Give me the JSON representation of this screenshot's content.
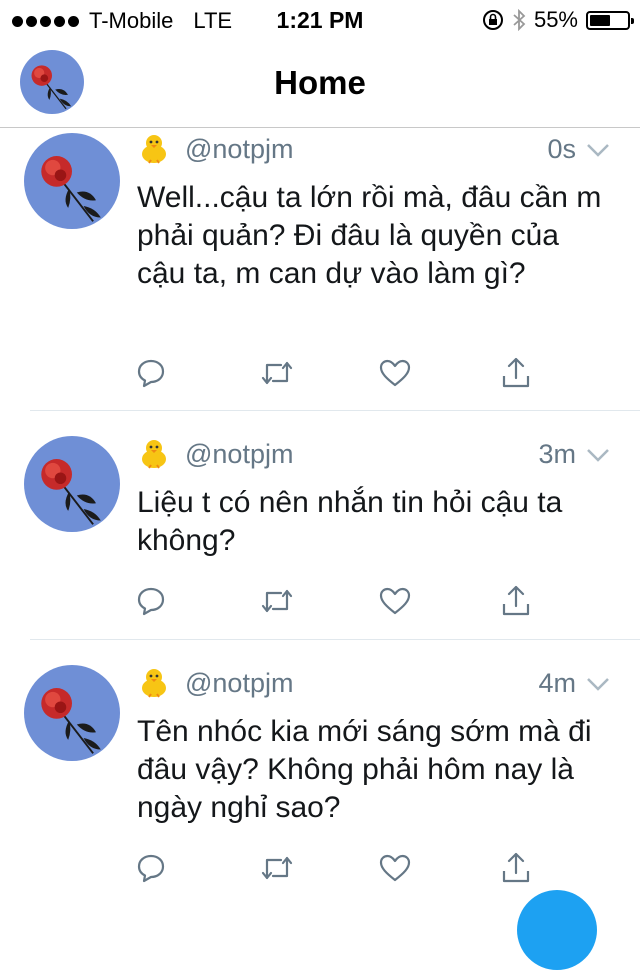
{
  "status_bar": {
    "carrier": "T-Mobile",
    "network": "LTE",
    "time": "1:21 PM",
    "battery_text": "55%",
    "battery_level": 0.55,
    "icons": [
      "signal-dots-icon",
      "rotation-lock-icon",
      "bluetooth-icon",
      "battery-icon"
    ]
  },
  "nav": {
    "title": "Home",
    "avatar_icon": "rose-avatar"
  },
  "colors": {
    "secondary_text": "#657786",
    "body_text": "#14171a",
    "avatar_bg": "#6f8fd6",
    "accent": "#1da1f2",
    "divider": "#e1e8ed"
  },
  "tweets": [
    {
      "handle": "@notpjm",
      "time": "0s",
      "text": "Well...cậu ta lớn rồi mà, đâu cần m phải quản? Đi đâu là quyền của cậu ta, m can dự vào làm gì?"
    },
    {
      "handle": "@notpjm",
      "time": "3m",
      "text": "Liệu t có nên nhắn tin hỏi cậu ta không?"
    },
    {
      "handle": "@notpjm",
      "time": "4m",
      "text": "Tên nhóc kia mới sáng sớm mà đi đâu vậy? Không phải hôm nay là ngày nghỉ sao?"
    }
  ],
  "action_icons": [
    "reply-icon",
    "retweet-icon",
    "like-icon",
    "share-icon"
  ]
}
